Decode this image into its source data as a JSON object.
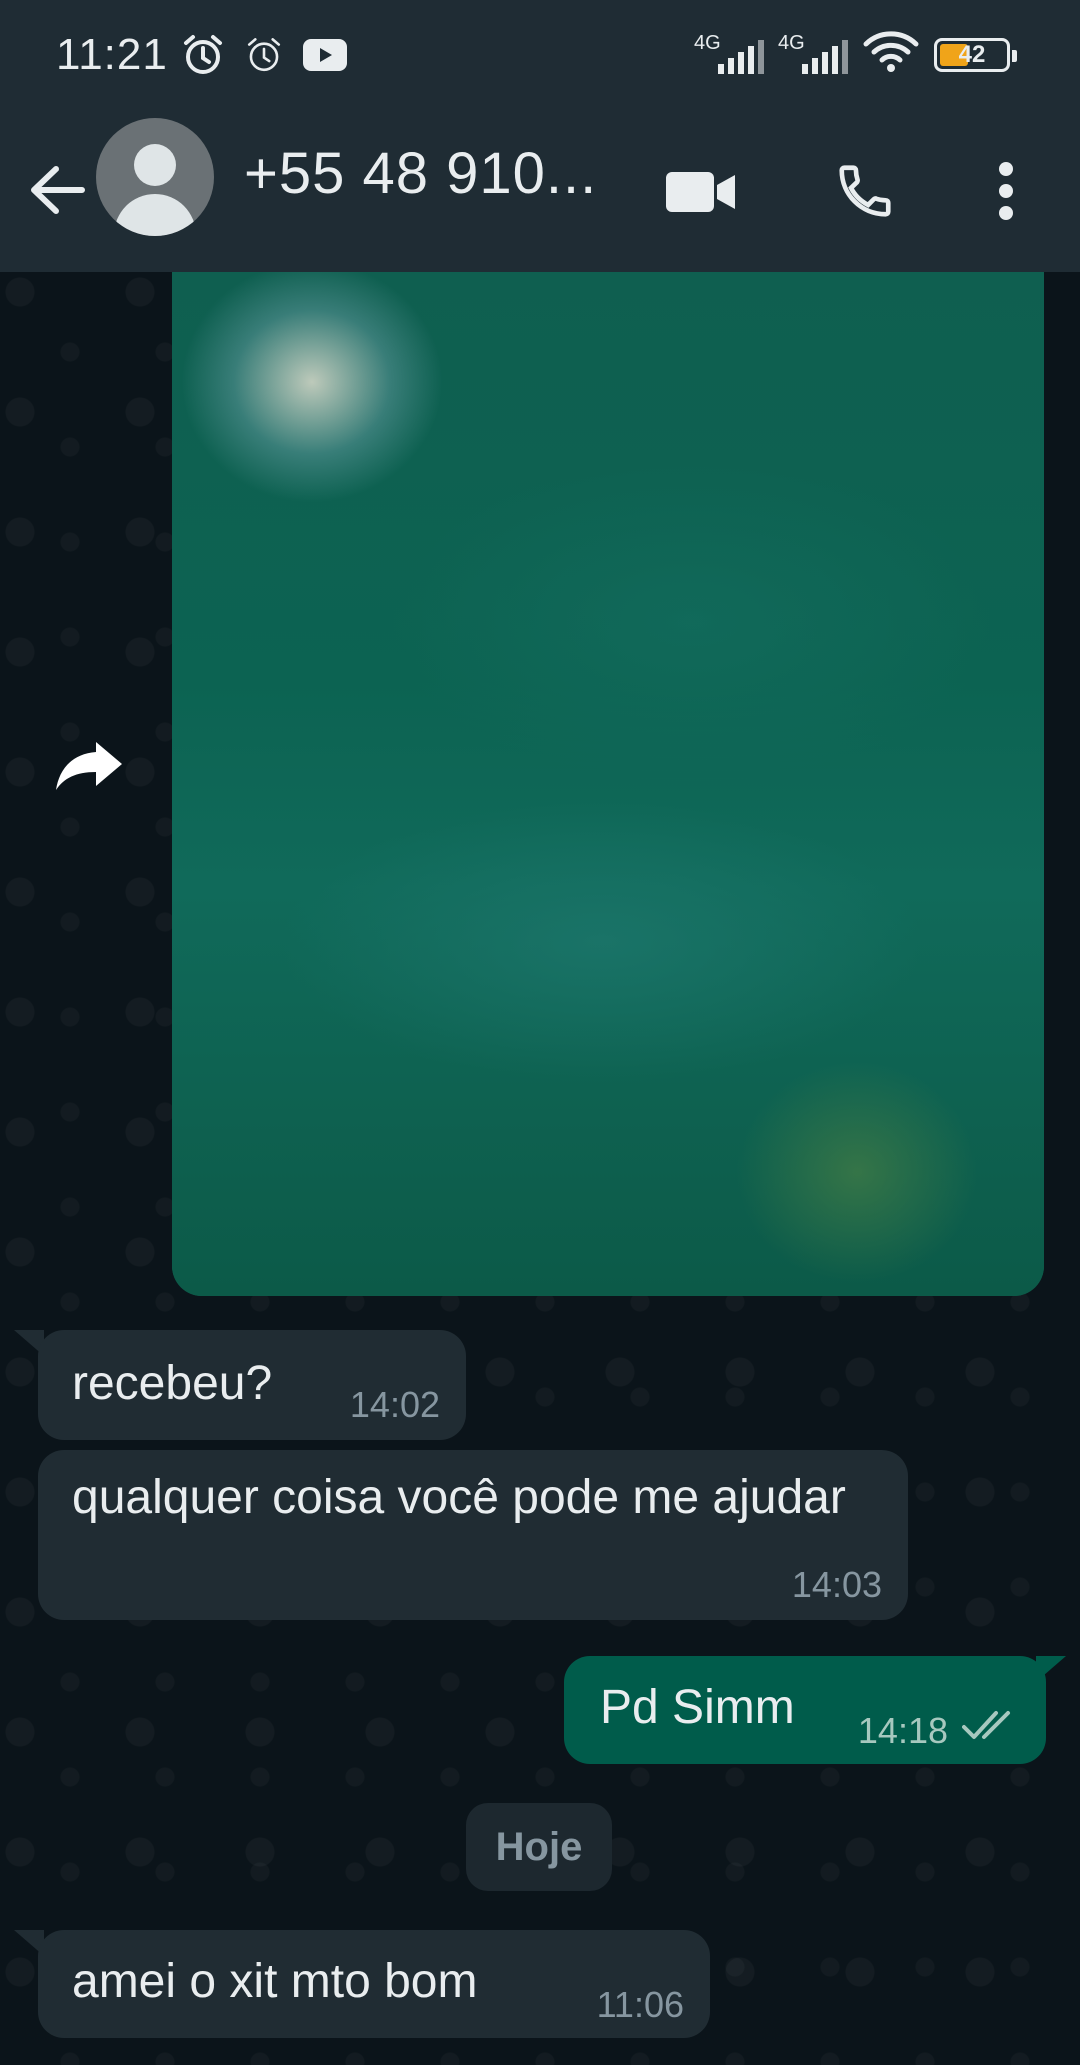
{
  "status_bar": {
    "time": "11:21",
    "network_1": "4G",
    "network_2": "4G",
    "battery": "42"
  },
  "header": {
    "contact_name": "+55 48 910..."
  },
  "messages": [
    {
      "direction": "incoming",
      "text": "recebeu?",
      "time": "14:02"
    },
    {
      "direction": "incoming",
      "text": "qualquer coisa você pode me ajudar",
      "time": "14:03"
    },
    {
      "direction": "outgoing",
      "text": "Pd Simm",
      "time": "14:18",
      "status": "read"
    },
    {
      "direction": "incoming",
      "text": "amei o xit mto bom",
      "time": "11:06"
    }
  ],
  "date_separator": "Hoje",
  "colors": {
    "app_bar": "#1f2c34",
    "chat_background": "#0b141a",
    "incoming_bubble": "#202c33",
    "outgoing_bubble": "#005c4b",
    "read_ticks": "#a7c8bf"
  }
}
